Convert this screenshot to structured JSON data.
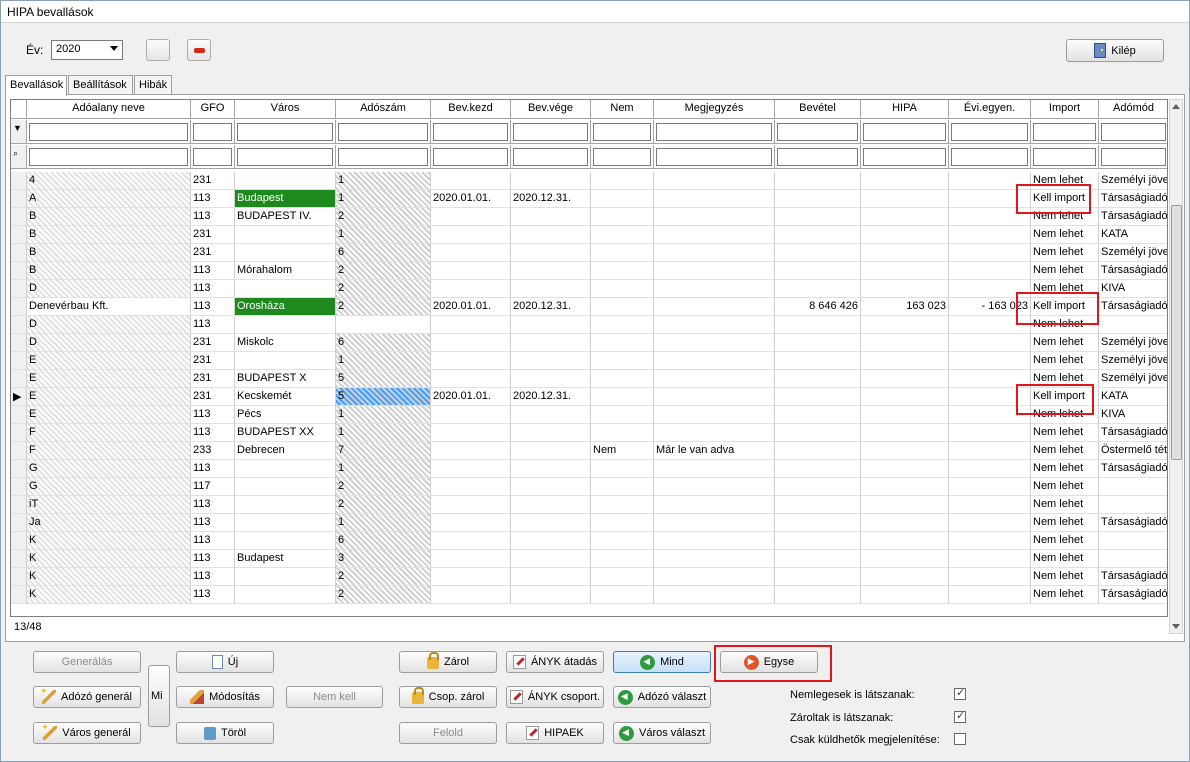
{
  "window": {
    "title": "HIPA bevallások"
  },
  "toolbar": {
    "year_label": "Év:",
    "year_value": "2020",
    "exit_label": "Kilép"
  },
  "tabs": [
    "Bevallások",
    "Beállítások",
    "Hibák"
  ],
  "grid": {
    "columns": [
      "Adóalany neve",
      "GFO",
      "Város",
      "Adószám",
      "Bev.kezd",
      "Bev.vége",
      "Nem",
      "Megjegyzés",
      "Bevétel",
      "HIPA",
      "Évi.egyen.",
      "Import",
      "Adómód"
    ],
    "rows": [
      {
        "name": "4",
        "gfo": "231",
        "city": "",
        "tax": "1",
        "start": "",
        "end": "",
        "nem": "",
        "note": "",
        "rev": "",
        "hipa": "",
        "evi": "",
        "imp": "Nem lehet",
        "mode": "Személyi jöve"
      },
      {
        "name": "A",
        "gfo": "113",
        "city": "Budapest",
        "tax": "1",
        "start": "2020.01.01.",
        "end": "2020.12.31.",
        "nem": "",
        "note": "",
        "rev": "",
        "hipa": "",
        "evi": "",
        "imp": "Kell import",
        "mode": "Társaságiadó"
      },
      {
        "name": "B",
        "gfo": "113",
        "city": "BUDAPEST IV.",
        "tax": "2",
        "start": "",
        "end": "",
        "nem": "",
        "note": "",
        "rev": "",
        "hipa": "",
        "evi": "",
        "imp": "Nem lehet",
        "mode": "Társaságiadó"
      },
      {
        "name": "B",
        "gfo": "231",
        "city": "",
        "tax": "1",
        "start": "",
        "end": "",
        "nem": "",
        "note": "",
        "rev": "",
        "hipa": "",
        "evi": "",
        "imp": "Nem lehet",
        "mode": "KATA"
      },
      {
        "name": "B",
        "gfo": "231",
        "city": "",
        "tax": "6",
        "start": "",
        "end": "",
        "nem": "",
        "note": "",
        "rev": "",
        "hipa": "",
        "evi": "",
        "imp": "Nem lehet",
        "mode": "Személyi jöve"
      },
      {
        "name": "B",
        "gfo": "113",
        "city": "Mórahalom",
        "tax": "2",
        "start": "",
        "end": "",
        "nem": "",
        "note": "",
        "rev": "",
        "hipa": "",
        "evi": "",
        "imp": "Nem lehet",
        "mode": "Társaságiadó"
      },
      {
        "name": "D",
        "gfo": "113",
        "city": "",
        "tax": "2",
        "start": "",
        "end": "",
        "nem": "",
        "note": "",
        "rev": "",
        "hipa": "",
        "evi": "",
        "imp": "Nem lehet",
        "mode": "KIVA"
      },
      {
        "name": "Denevérbau Kft.",
        "gfo": "113",
        "city": "Orosháza",
        "tax": "2",
        "start": "2020.01.01.",
        "end": "2020.12.31.",
        "nem": "",
        "note": "",
        "rev": "8 646 426",
        "hipa": "163 023",
        "evi": "- 163 023",
        "imp": "Kell import",
        "mode": "Társaságiadó"
      },
      {
        "name": "D",
        "gfo": "113",
        "city": "",
        "tax": "",
        "start": "",
        "end": "",
        "nem": "",
        "note": "",
        "rev": "",
        "hipa": "",
        "evi": "",
        "imp": "Nem lehet",
        "mode": ""
      },
      {
        "name": "D",
        "gfo": "231",
        "city": "Miskolc",
        "tax": "6",
        "start": "",
        "end": "",
        "nem": "",
        "note": "",
        "rev": "",
        "hipa": "",
        "evi": "",
        "imp": "Nem lehet",
        "mode": "Személyi jöve"
      },
      {
        "name": "E",
        "gfo": "231",
        "city": "",
        "tax": "1",
        "start": "",
        "end": "",
        "nem": "",
        "note": "",
        "rev": "",
        "hipa": "",
        "evi": "",
        "imp": "Nem lehet",
        "mode": "Személyi jöve"
      },
      {
        "name": "E",
        "gfo": "231",
        "city": "BUDAPEST X",
        "tax": "5",
        "start": "",
        "end": "",
        "nem": "",
        "note": "",
        "rev": "",
        "hipa": "",
        "evi": "",
        "imp": "Nem lehet",
        "mode": "Személyi jöve"
      },
      {
        "name": "E",
        "gfo": "231",
        "city": "Kecskemét",
        "tax": "5",
        "start": "2020.01.01.",
        "end": "2020.12.31.",
        "nem": "",
        "note": "",
        "rev": "",
        "hipa": "",
        "evi": "",
        "imp": "Kell import",
        "mode": "KATA"
      },
      {
        "name": "E",
        "gfo": "113",
        "city": "Pécs",
        "tax": "1",
        "start": "",
        "end": "",
        "nem": "",
        "note": "",
        "rev": "",
        "hipa": "",
        "evi": "",
        "imp": "Nem lehet",
        "mode": "KIVA"
      },
      {
        "name": "F",
        "gfo": "113",
        "city": "BUDAPEST XX",
        "tax": "1",
        "start": "",
        "end": "",
        "nem": "",
        "note": "",
        "rev": "",
        "hipa": "",
        "evi": "",
        "imp": "Nem lehet",
        "mode": "Társaságiadó"
      },
      {
        "name": "F",
        "gfo": "233",
        "city": "Debrecen",
        "tax": "7",
        "start": "",
        "end": "",
        "nem": "Nem",
        "note": "Már le van adva",
        "rev": "",
        "hipa": "",
        "evi": "",
        "imp": "Nem lehet",
        "mode": "Östermelő téte"
      },
      {
        "name": "G",
        "gfo": "113",
        "city": "",
        "tax": "1",
        "start": "",
        "end": "",
        "nem": "",
        "note": "",
        "rev": "",
        "hipa": "",
        "evi": "",
        "imp": "Nem lehet",
        "mode": "Társaságiadó"
      },
      {
        "name": "G",
        "gfo": "117",
        "city": "",
        "tax": "2",
        "start": "",
        "end": "",
        "nem": "",
        "note": "",
        "rev": "",
        "hipa": "",
        "evi": "",
        "imp": "Nem lehet",
        "mode": ""
      },
      {
        "name": "iT",
        "gfo": "113",
        "city": "",
        "tax": "2",
        "start": "",
        "end": "",
        "nem": "",
        "note": "",
        "rev": "",
        "hipa": "",
        "evi": "",
        "imp": "Nem lehet",
        "mode": ""
      },
      {
        "name": "Ja",
        "gfo": "113",
        "city": "",
        "tax": "1",
        "start": "",
        "end": "",
        "nem": "",
        "note": "",
        "rev": "",
        "hipa": "",
        "evi": "",
        "imp": "Nem lehet",
        "mode": "Társaságiadó"
      },
      {
        "name": "K",
        "gfo": "113",
        "city": "",
        "tax": "6",
        "start": "",
        "end": "",
        "nem": "",
        "note": "",
        "rev": "",
        "hipa": "",
        "evi": "",
        "imp": "Nem lehet",
        "mode": ""
      },
      {
        "name": "K",
        "gfo": "113",
        "city": "Budapest",
        "tax": "3",
        "start": "",
        "end": "",
        "nem": "",
        "note": "",
        "rev": "",
        "hipa": "",
        "evi": "",
        "imp": "Nem lehet",
        "mode": ""
      },
      {
        "name": "K",
        "gfo": "113",
        "city": "",
        "tax": "2",
        "start": "",
        "end": "",
        "nem": "",
        "note": "",
        "rev": "",
        "hipa": "",
        "evi": "",
        "imp": "Nem lehet",
        "mode": "Társaságiadó"
      },
      {
        "name": "K",
        "gfo": "113",
        "city": "",
        "tax": "2",
        "start": "",
        "end": "",
        "nem": "",
        "note": "",
        "rev": "",
        "hipa": "",
        "evi": "",
        "imp": "Nem lehet",
        "mode": "Társaságiadó"
      }
    ],
    "record_count": "13/48"
  },
  "buttons": {
    "generalas": "Generálás",
    "adozo_general": "Adózó generál",
    "varos_general": "Város generál",
    "mi": "Mi",
    "uj": "Új",
    "modositas": "Módosítás",
    "torol": "Töröl",
    "nem_kell": "Nem kell",
    "zarol": "Zárol",
    "csop_zarol": "Csop. zárol",
    "felold": "Felold",
    "anyk_atadas": "ÁNYK átadás",
    "anyk_csoport": "ÁNYK csoport.",
    "hipaek": "HIPAEK",
    "mind": "Mind",
    "adozo_valaszt": "Adózó választ",
    "varos_valaszt": "Város választ",
    "egyse": "Egyse"
  },
  "checks": {
    "nemlegesek": "Nemlegesek is látszanak:",
    "zaroltak": "Zároltak is látszanak:",
    "csak_kuldhetok": "Csak küldhetők megjelenítése:"
  },
  "colors": {
    "highlight_green": "#1e8a1e",
    "selected_blue": "#3ea0ff",
    "annotation_red": "#e4141c"
  }
}
